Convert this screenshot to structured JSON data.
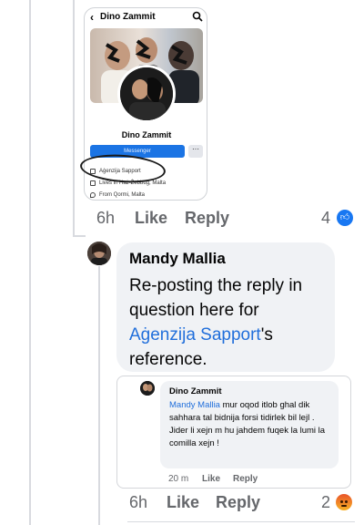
{
  "profile_screenshot": {
    "title": "Dino Zammit",
    "name": "Dino Zammit",
    "button_label": "Messenger",
    "info": [
      "Aġenzija Sapport",
      "Lives in Ħaż-Żebbuġ, Malta",
      "From Qormi, Malta"
    ]
  },
  "post_actions": {
    "time": "6h",
    "like": "Like",
    "reply": "Reply",
    "reaction_count": "4"
  },
  "comment": {
    "author": "Mandy Mallia",
    "text_before": "Re-posting the reply in question here for ",
    "mention": "Aġenzija Sapport",
    "text_after": "'s reference."
  },
  "quoted_reply": {
    "author": "Dino Zammit",
    "mention": "Mandy Mallia",
    "text": " mur oqod itlob ghal dik sahhara tal bidnija forsi tidirlek bil lejl . Jider li xejn m hu jahdem fuqek la lumi la comilla xejn !",
    "time": "20 m",
    "like": "Like",
    "reply": "Reply"
  },
  "comment_actions": {
    "time": "6h",
    "like": "Like",
    "reply": "Reply",
    "reaction_count": "2"
  },
  "colors": {
    "like_blue": "#1877f2",
    "mention_blue": "#216fdb",
    "meta_gray": "#65676b",
    "bubble_bg": "#f0f2f5"
  }
}
